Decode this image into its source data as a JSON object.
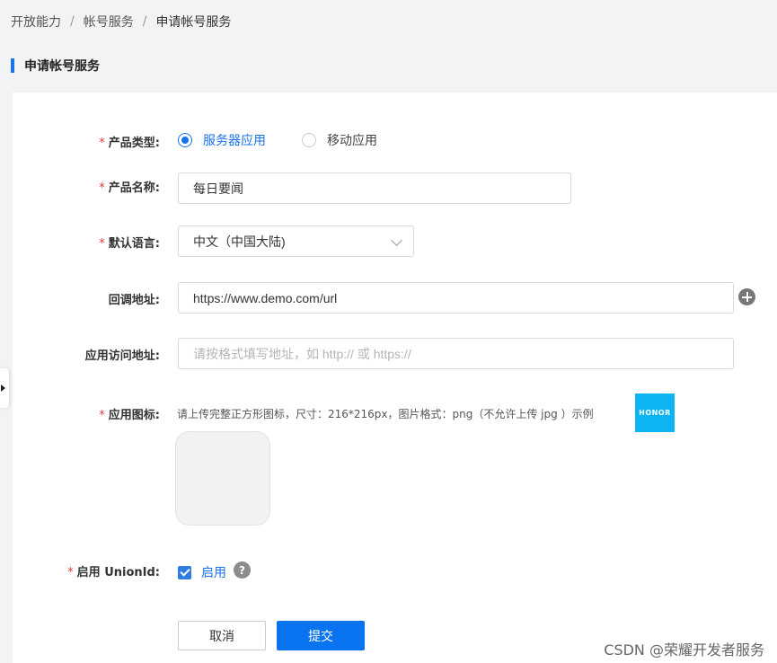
{
  "breadcrumb": [
    "开放能力",
    "帐号服务",
    "申请帐号服务"
  ],
  "breadcrumb_separator": "/",
  "section_title": "申请帐号服务",
  "form": {
    "product_type": {
      "label": "产品类型:",
      "required": "*",
      "options": [
        "服务器应用",
        "移动应用"
      ],
      "selected": "服务器应用"
    },
    "product_name": {
      "label": "产品名称:",
      "required": "*",
      "value": "每日要闻"
    },
    "default_language": {
      "label": "默认语言:",
      "required": "*",
      "value": "中文（中国大陆)"
    },
    "callback_url": {
      "label": "回调地址:",
      "value": "https://www.demo.com/url"
    },
    "app_access_url": {
      "label": "应用访问地址:",
      "placeholder": "请按格式填写地址，如 http:// 或 https://"
    },
    "app_icon": {
      "label": "应用图标:",
      "required": "*",
      "hint": "请上传完整正方形图标，尺寸：216*216px，图片格式：png（不允许上传 jpg ）示例",
      "example_logo_text": "HONOR"
    },
    "unionid": {
      "label": "启用 UnionId:",
      "required": "*",
      "checkbox_label": "启用",
      "checked": true,
      "help": "?"
    }
  },
  "buttons": {
    "cancel": "取消",
    "submit": "提交"
  },
  "watermark": "CSDN @荣耀开发者服务",
  "colors": {
    "accent": "#1a73e8",
    "submit": "#0a74f0",
    "honor": "#0db4f2",
    "required": "#e53935"
  }
}
